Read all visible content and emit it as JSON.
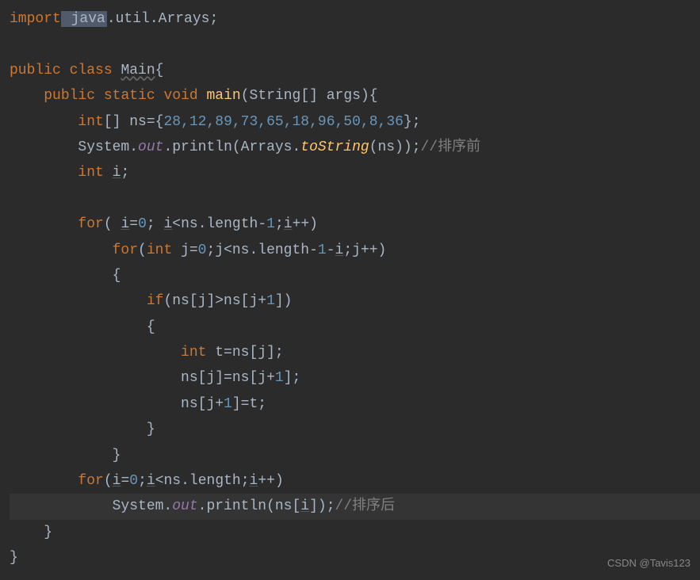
{
  "code": {
    "line1": {
      "kw_import": "import",
      "highlight": " java",
      "rest": ".util.Arrays;"
    },
    "line2": "",
    "line3": {
      "kw_public": "public",
      "kw_class": "class",
      "classname": "Main",
      "brace": "{"
    },
    "line4": {
      "indent": "    ",
      "kw_public": "public",
      "kw_static": "static",
      "kw_void": "void",
      "method": "main",
      "params": "(String[] args){"
    },
    "line5": {
      "indent": "        ",
      "type": "int",
      "brackets": "[] ",
      "var": "ns",
      "eq": "=",
      "brace_open": "{",
      "nums": "28,12,89,73,65,18,96,50,8,36",
      "brace_close": "};"
    },
    "line6": {
      "indent": "        ",
      "sys": "System.",
      "out": "out",
      "dot": ".println(Arrays.",
      "tostring": "toString",
      "rest": "(ns));",
      "comment": "//排序前"
    },
    "line7": {
      "indent": "        ",
      "type": "int",
      "sp": " ",
      "var": "i",
      "semi": ";"
    },
    "line8": "",
    "line9": {
      "indent": "        ",
      "kw_for": "for",
      "open": "( ",
      "var_i": "i",
      "eq": "=",
      "zero": "0",
      "semi1": "; ",
      "var_i2": "i",
      "lt": "<ns.length-",
      "one": "1",
      "semi2": ";",
      "var_i3": "i",
      "inc": "++)"
    },
    "line10": {
      "indent": "            ",
      "kw_for": "for",
      "open": "(",
      "type": "int",
      "sp": " j=",
      "zero": "0",
      "semi1": ";j<ns.length-",
      "one": "1",
      "minus": "-",
      "var_i": "i",
      "semi2": ";j++)"
    },
    "line11": {
      "indent": "            ",
      "brace": "{"
    },
    "line12": {
      "indent": "                ",
      "kw_if": "if",
      "cond": "(ns[j]>ns[j+",
      "one": "1",
      "close": "])"
    },
    "line13": {
      "indent": "                ",
      "brace": "{"
    },
    "line14": {
      "indent": "                    ",
      "type": "int",
      "rest": " t=ns[j];"
    },
    "line15": {
      "indent": "                    ",
      "text": "ns[j]=ns[j+",
      "one": "1",
      "close": "];"
    },
    "line16": {
      "indent": "                    ",
      "text": "ns[j+",
      "one": "1",
      "close": "]=t;"
    },
    "line17": {
      "indent": "                ",
      "brace": "}"
    },
    "line18": {
      "indent": "            ",
      "brace": "}"
    },
    "line19": {
      "indent": "        ",
      "kw_for": "for",
      "open": "(",
      "var_i": "i",
      "eq": "=",
      "zero": "0",
      "semi1": ";",
      "var_i2": "i",
      "lt": "<ns.length;",
      "var_i3": "i",
      "inc": "++)"
    },
    "line20": {
      "indent": "            ",
      "sys": "System.",
      "out": "out",
      "rest": ".println(ns[",
      "var_i": "i",
      "close": "]);",
      "comment": "//排序后"
    },
    "line21": {
      "indent": "    ",
      "brace": "}"
    },
    "line22": {
      "brace": "}"
    }
  },
  "watermark": "CSDN @Tavis123"
}
